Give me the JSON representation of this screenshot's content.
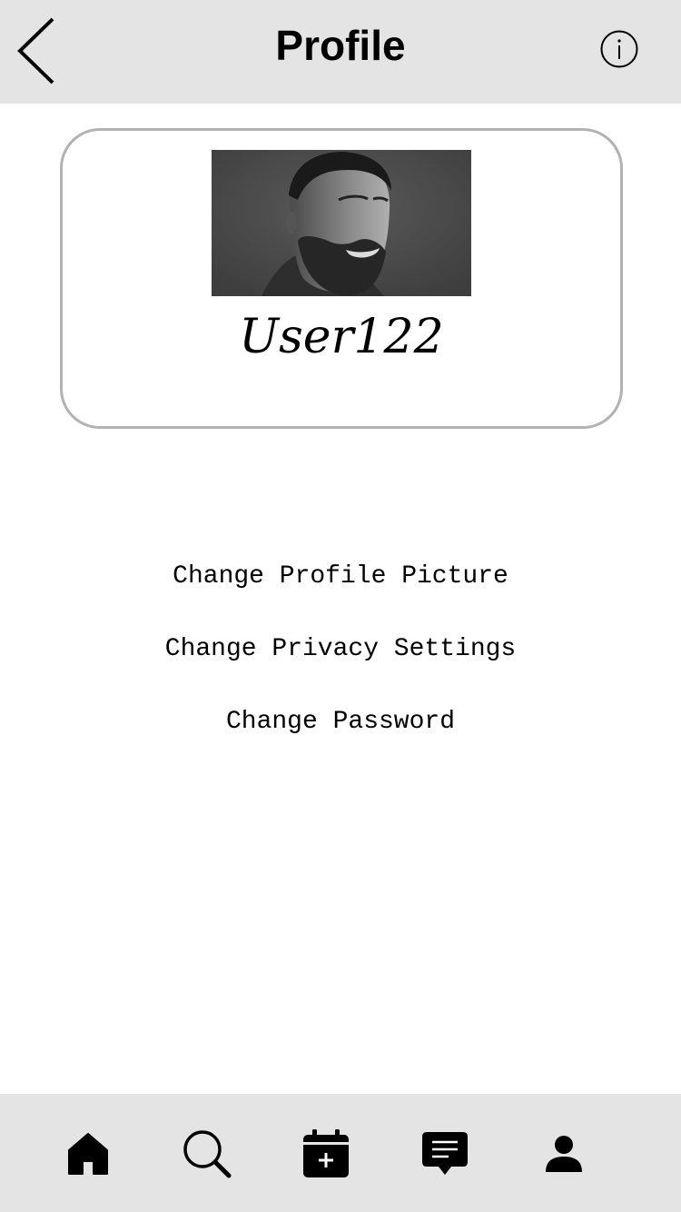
{
  "header": {
    "title": "Profile",
    "back_icon": "chevron-left-icon",
    "info_icon": "info-icon"
  },
  "profile": {
    "username": "User122",
    "avatar": "profile-photo"
  },
  "settings": [
    {
      "label": "Change Profile Picture"
    },
    {
      "label": "Change Privacy Settings"
    },
    {
      "label": "Change Password"
    }
  ],
  "tabbar": {
    "items": [
      {
        "icon": "home-icon"
      },
      {
        "icon": "search-icon"
      },
      {
        "icon": "calendar-add-icon"
      },
      {
        "icon": "message-icon"
      },
      {
        "icon": "person-icon"
      }
    ]
  },
  "colors": {
    "bar_background": "#e4e4e4",
    "card_border": "#b2b2b2",
    "text": "#000000"
  }
}
